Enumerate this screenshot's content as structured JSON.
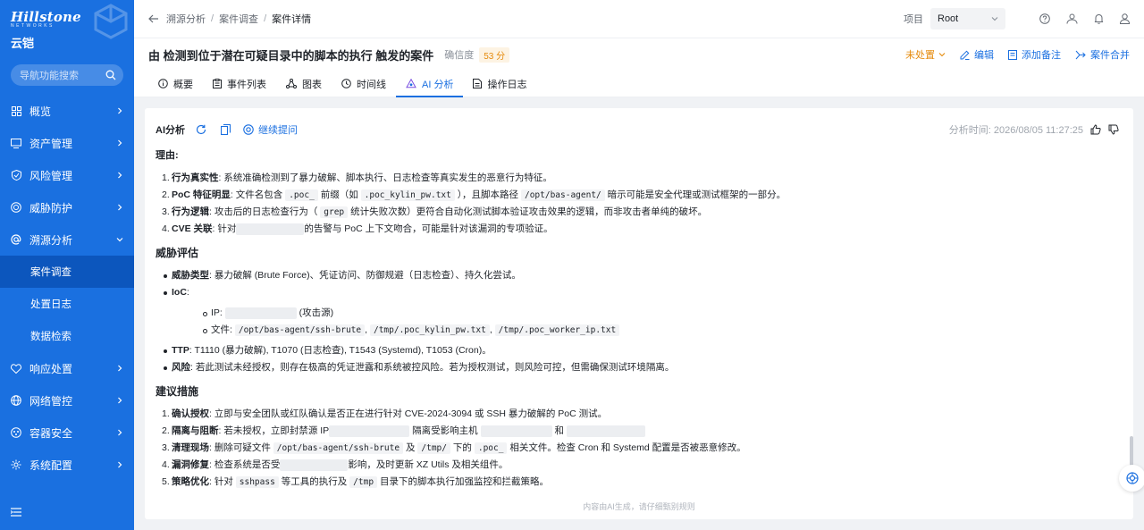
{
  "brand": {
    "name": "Hillstone",
    "subtitle": "NETWORKS",
    "product": "云铠"
  },
  "colors": {
    "primary": "#1a70e0",
    "warning": "#e58a0b"
  },
  "nav_search": {
    "placeholder": "导航功能搜索"
  },
  "nav": [
    {
      "label": "概览",
      "icon": "grid-icon"
    },
    {
      "label": "资产管理",
      "icon": "monitor-icon"
    },
    {
      "label": "风险管理",
      "icon": "shield-icon"
    },
    {
      "label": "威胁防护",
      "icon": "target-icon"
    },
    {
      "label": "溯源分析",
      "icon": "at-icon",
      "expanded": true
    },
    {
      "label": "响应处置",
      "icon": "response-icon"
    },
    {
      "label": "网络管控",
      "icon": "globe-icon"
    },
    {
      "label": "容器安全",
      "icon": "container-icon"
    },
    {
      "label": "系统配置",
      "icon": "gear-icon"
    }
  ],
  "nav_sub": [
    {
      "label": "案件调查",
      "active": true
    },
    {
      "label": "处置日志"
    },
    {
      "label": "数据检索"
    }
  ],
  "breadcrumb": [
    "溯源分析",
    "案件调查",
    "案件详情"
  ],
  "project": {
    "label": "项目",
    "value": "Root"
  },
  "page_title": "由 检测到位于潜在可疑目录中的脚本的执行 触发的案件",
  "confidence": {
    "label": "确信度",
    "value": "53 分"
  },
  "actions": {
    "status": "未处置",
    "edit": "编辑",
    "add_note": "添加备注",
    "merge": "案件合并"
  },
  "tabs": [
    {
      "label": "概要",
      "icon": "info-icon"
    },
    {
      "label": "事件列表",
      "icon": "clipboard-icon"
    },
    {
      "label": "图表",
      "icon": "graph-icon"
    },
    {
      "label": "时间线",
      "icon": "clock-icon"
    },
    {
      "label": "AI 分析",
      "icon": "ai-icon",
      "active": true
    },
    {
      "label": "操作日志",
      "icon": "log-icon"
    }
  ],
  "ai": {
    "title": "AI分析",
    "follow_up": "继续提问",
    "time": "分析时间: 2026/08/05 11:27:25",
    "reason_title": "理由:",
    "reasons": {
      "r1_b": "行为真实性",
      "r1": ": 系统准确检测到了暴力破解、脚本执行、日志检查等真实发生的恶意行为特征。",
      "r2_b": "PoC 特征明显",
      "r2_a": ": 文件名包含 ",
      "r2_c1": ".poc_",
      "r2_m1": " 前缀（如 ",
      "r2_c2": ".poc_kylin_pw.txt",
      "r2_m2": " ），且脚本路径 ",
      "r2_c3": "/opt/bas-agent/",
      "r2_e": " 暗示可能是安全代理或测试框架的一部分。",
      "r3_b": "行为逻辑",
      "r3_a": ": 攻击后的日志检查行为（ ",
      "r3_c": "grep",
      "r3_e": " 统计失败次数）更符合自动化测试脚本验证攻击效果的逻辑，而非攻击者单纯的破坏。",
      "r4_b": "CVE 关联",
      "r4_a": ": 针对",
      "r4_e": "的告警与 PoC 上下文吻合，可能是针对该漏洞的专项验证。"
    },
    "threat_title": "威胁评估",
    "threat": {
      "t1_b": "威胁类型",
      "t1": ": 暴力破解 (Brute Force)、凭证访问、防御规避（日志检查）、持久化尝试。",
      "t2_b": "IoC",
      "t2": ":",
      "ip_a": "IP: ",
      "ip_e": " (攻击源)",
      "file_a": "文件: ",
      "file_c1": "/opt/bas-agent/ssh-brute",
      "file_c2": "/tmp/.poc_kylin_pw.txt",
      "file_c3": "/tmp/.poc_worker_ip.txt",
      "comma": ", ",
      "t3_b": "TTP",
      "t3": ": T1110 (暴力破解), T1070 (日志检查), T1543 (Systemd), T1053 (Cron)。",
      "t4_b": "风险",
      "t4": ": 若此测试未经授权，则存在极高的凭证泄露和系统被控风险。若为授权测试，则风险可控，但需确保测试环境隔离。"
    },
    "advice_title": "建议措施",
    "advice": {
      "a1_b": "确认授权",
      "a1": ": 立即与安全团队或红队确认是否正在进行针对 CVE-2024-3094 或 SSH 暴力破解的 PoC 测试。",
      "a2_b": "隔离与阻断",
      "a2_a": ": 若未授权，立即封禁源 IP",
      "a2_m": " 隔离受影响主机 ",
      "a2_and": " 和 ",
      "a3_b": "清理现场",
      "a3_a": ": 删除可疑文件 ",
      "a3_c1": "/opt/bas-agent/ssh-brute",
      "a3_m1": " 及 ",
      "a3_c2": "/tmp/",
      "a3_m2": " 下的 ",
      "a3_c3": ".poc_",
      "a3_e": " 相关文件。检查 Cron 和 Systemd 配置是否被恶意修改。",
      "a4_b": "漏洞修复",
      "a4_a": ": 检查系统是否受",
      "a4_e": "影响，及时更新 XZ Utils 及相关组件。",
      "a5_b": "策略优化",
      "a5_a": ": 针对 ",
      "a5_c1": "sshpass",
      "a5_m": " 等工具的执行及 ",
      "a5_c2": "/tmp",
      "a5_e": " 目录下的脚本执行加强监控和拦截策略。"
    },
    "footnote": "内容由AI生成，请仔细甄别规则"
  }
}
